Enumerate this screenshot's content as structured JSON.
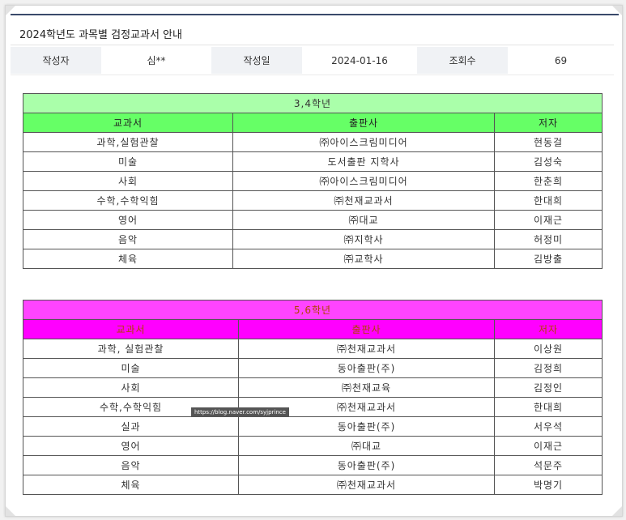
{
  "post": {
    "title": "2024학년도 과목별 검정교과서 안내",
    "author_label": "작성자",
    "author": "심**",
    "date_label": "작성일",
    "date": "2024-01-16",
    "views_label": "조회수",
    "views": "69"
  },
  "table34": {
    "caption": "3,4학년",
    "headers": [
      "교과서",
      "출판사",
      "저자"
    ],
    "rows": [
      [
        "과학,실험관찰",
        "㈜아이스크림미디어",
        "현동걸"
      ],
      [
        "미술",
        "도서출판 지학사",
        "김성숙"
      ],
      [
        "사회",
        "㈜아이스크림미디어",
        "한춘희"
      ],
      [
        "수학,수학익힘",
        "㈜천재교과서",
        "한대희"
      ],
      [
        "영어",
        "㈜대교",
        "이재근"
      ],
      [
        "음악",
        "㈜지학사",
        "허정미"
      ],
      [
        "체육",
        "㈜교학사",
        "김방출"
      ]
    ]
  },
  "table56": {
    "caption": "5,6학년",
    "headers": [
      "교과서",
      "출판사",
      "저자"
    ],
    "rows": [
      [
        "과학, 실험관찰",
        "㈜천재교과서",
        "이상원"
      ],
      [
        "미술",
        "동아출판(주)",
        "김정희"
      ],
      [
        "사회",
        "㈜천재교육",
        "김정인"
      ],
      [
        "수학,수학익힘",
        "㈜천재교과서",
        "한대희"
      ],
      [
        "실과",
        "동아출판(주)",
        "서우석"
      ],
      [
        "영어",
        "㈜대교",
        "이재근"
      ],
      [
        "음악",
        "동아출판(주)",
        "석문주"
      ],
      [
        "체육",
        "㈜천재교과서",
        "박명기"
      ]
    ]
  },
  "watermark": "https://blog.naver.com/syjprince",
  "colors": {
    "green_caption": "#aaffaa",
    "green_header": "#66ff66",
    "magenta_caption": "#ff44ff",
    "magenta_header": "#ff00ff",
    "title_rule": "#3a4a6b"
  }
}
